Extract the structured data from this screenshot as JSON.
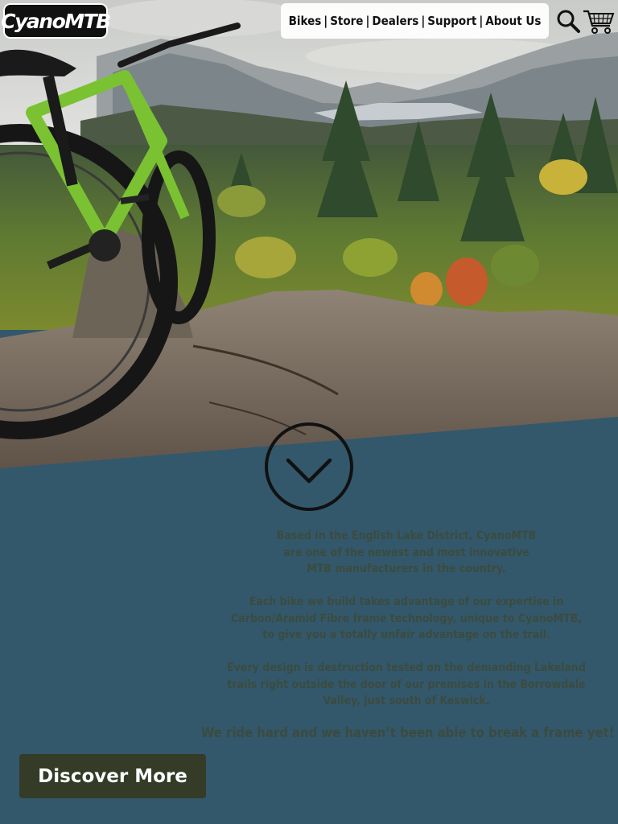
{
  "brand": {
    "logo_text": "CyanoMTB"
  },
  "nav": {
    "items": [
      {
        "label": "Bikes"
      },
      {
        "label": "Store"
      },
      {
        "label": "Dealers"
      },
      {
        "label": "Support"
      },
      {
        "label": "About Us"
      }
    ],
    "separator": "|"
  },
  "header_icons": {
    "search": "search-icon",
    "cart": "cart-icon"
  },
  "scroll_icon": "chevron-down-icon",
  "intro": {
    "paragraphs": [
      "Based in the English Lake District, CyanoMTB\nare one of the newest and most innovative\nMTB manufacturers in the country.",
      "Each bike we build takes advantage of our expertise in\nCarbon/Aramid Fibre frame technology, unique to CyanoMTB,\nto give you a totally unfair advantage on the trail.",
      "Every design is destruction tested on the demanding Lakeland\ntrails right outside the door of our premises in the Borrowdale\nValley, just south of Keswick."
    ],
    "tagline": "We ride hard and we haven’t been able to break a frame yet!"
  },
  "cta": {
    "label": "Discover More"
  },
  "colors": {
    "panel_bg": "#33586b",
    "copy_text": "#3b4b40",
    "cta_bg": "#343c27",
    "bike_frame": "#7ac232"
  }
}
